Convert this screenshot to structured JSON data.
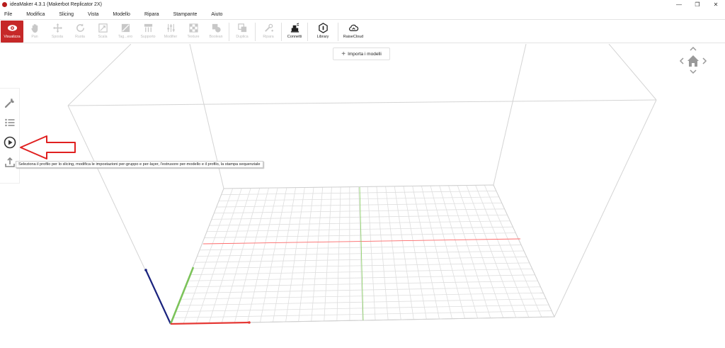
{
  "window": {
    "title": "ideaMaker 4.3.1 (Makerbot Replicator 2X)",
    "controls": [
      "minimize-icon",
      "restore-icon",
      "close-icon"
    ]
  },
  "menu": [
    "File",
    "Modifica",
    "Slicing",
    "Vista",
    "Modello",
    "Ripara",
    "Stampante",
    "Aiuto"
  ],
  "toolbar": {
    "visualizza": "Visualizza",
    "pan": "Pan",
    "sposta": "Sposta",
    "ruota": "Ruota",
    "scala": "Scala",
    "taglia": "Tag...ero",
    "supporto": "Supporto",
    "modifier": "Modifier",
    "texture": "Texture",
    "boolean": "Boolean",
    "duplica": "Duplica",
    "ripara": "Ripara",
    "connetti": "Connetti",
    "library": "Library",
    "raisecloud": "RaiseCloud"
  },
  "viewport": {
    "import_label": "Importa i modelli",
    "tooltip": "Seleziona il profilo per lo slicing, modifica le impostazioni per-gruppo e per-layer, l'estrusore per-modello e il profilo, la stampa sequenziale",
    "sidebar_icons": [
      "wrench-icon",
      "list-icon",
      "play-icon",
      "upload-icon"
    ],
    "nav_icons": [
      "chevron-up-icon",
      "chevron-left-icon",
      "home-icon",
      "chevron-right-icon",
      "chevron-down-icon"
    ]
  },
  "colors": {
    "accent": "#c62828",
    "x_axis": "#e53935",
    "y_axis": "#7cc35a",
    "z_axis": "#1a237e",
    "annotation_arrow": "#e02020"
  }
}
